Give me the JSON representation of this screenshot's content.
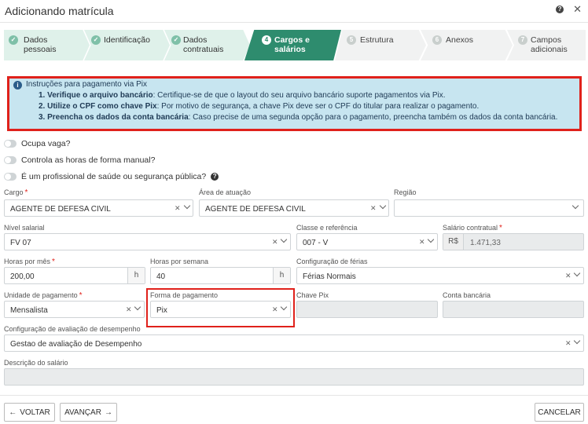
{
  "header": {
    "title": "Adicionando matrícula",
    "help_icon": "?",
    "close_icon": "✕"
  },
  "steps": [
    {
      "num": "✓",
      "line1": "Dados",
      "line2": "pessoais",
      "state": "done"
    },
    {
      "num": "✓",
      "line1": "Identificação",
      "line2": "",
      "state": "done"
    },
    {
      "num": "✓",
      "line1": "Dados",
      "line2": "contratuais",
      "state": "done"
    },
    {
      "num": "4",
      "line1": "Cargos e",
      "line2": "salários",
      "state": "active"
    },
    {
      "num": "5",
      "line1": "Estrutura",
      "line2": "",
      "state": "todo"
    },
    {
      "num": "6",
      "line1": "Anexos",
      "line2": "",
      "state": "todo"
    },
    {
      "num": "7",
      "line1": "Campos",
      "line2": "adicionais",
      "state": "todo"
    }
  ],
  "alert": {
    "title": "Instruções para pagamento via Pix",
    "item1_bold": "1. Verifique o arquivo bancário",
    "item1_text": ": Certifique-se de que o layout do seu arquivo bancário suporte pagamentos via Pix.",
    "item2_bold": "2. Utilize o CPF como chave Pix",
    "item2_text": ": Por motivo de segurança, a chave Pix deve ser o CPF do titular para realizar o pagamento.",
    "item3_bold": "3. Preencha os dados da conta bancária",
    "item3_text": ": Caso precise de uma segunda opção para o pagamento, preencha também os dados da conta bancária."
  },
  "toggles": {
    "ocupa_vaga": "Ocupa vaga?",
    "horas_manual": "Controla as horas de forma manual?",
    "profissional_saude": "É um profissional de saúde ou segurança pública?"
  },
  "fields": {
    "cargo": {
      "label": "Cargo",
      "value": "AGENTE DE DEFESA CIVIL"
    },
    "area_atuacao": {
      "label": "Área de atuação",
      "value": "AGENTE DE DEFESA CIVIL"
    },
    "regiao": {
      "label": "Região",
      "value": ""
    },
    "nivel_salarial": {
      "label": "Nível salarial",
      "value": "FV 07"
    },
    "classe_referencia": {
      "label": "Classe e referência",
      "value": "007 - V"
    },
    "salario_contratual": {
      "label": "Salário contratual",
      "prefix": "R$",
      "value": "1.471,33"
    },
    "horas_mes": {
      "label": "Horas por mês",
      "value": "200,00",
      "suffix": "h"
    },
    "horas_semana": {
      "label": "Horas por semana",
      "value": "40",
      "suffix": "h"
    },
    "config_ferias": {
      "label": "Configuração de férias",
      "value": "Férias Normais"
    },
    "unidade_pagamento": {
      "label": "Unidade de pagamento",
      "value": "Mensalista"
    },
    "forma_pagamento": {
      "label": "Forma de pagamento",
      "value": "Pix"
    },
    "chave_pix": {
      "label": "Chave Pix",
      "value": ""
    },
    "conta_bancaria": {
      "label": "Conta bancária",
      "value": ""
    },
    "config_avaliacao": {
      "label": "Configuração de avaliação de desempenho",
      "value": "Gestao de avaliação de Desempenho"
    },
    "descricao_salario": {
      "label": "Descrição do salário",
      "value": ""
    }
  },
  "buttons": {
    "voltar": "VOLTAR",
    "avancar": "AVANÇAR",
    "cancelar": "CANCELAR"
  },
  "colors": {
    "accent": "#2e8c6e",
    "highlight": "#e0211b",
    "alert_bg": "#c7e5f0"
  }
}
